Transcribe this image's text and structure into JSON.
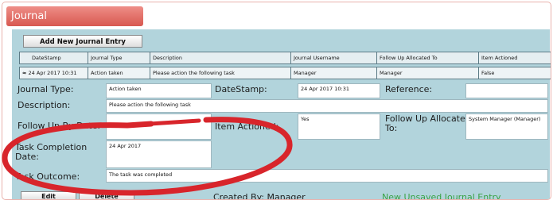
{
  "panel": {
    "title": "Journal"
  },
  "toolbar": {
    "add_label": "Add New Journal Entry"
  },
  "grid": {
    "headers": [
      "DateStamp",
      "Journal Type",
      "Description",
      "Journal Username",
      "Follow Up Allocated To",
      "Item Actioned"
    ],
    "expand_glyph": "≈",
    "row": [
      "24 Apr 2017 10:31",
      "Action taken",
      "Please action the following task",
      "Manager",
      "Manager",
      "False"
    ]
  },
  "form": {
    "journal_type_label": "Journal Type:",
    "journal_type_value": "Action taken",
    "datestamp_label": "DateStamp:",
    "datestamp_value": "24 Apr 2017 10:31",
    "reference_label": "Reference:",
    "reference_value": "",
    "description_label": "Description:",
    "description_value": "Please action the following task",
    "follow_up_by_date_label": "Follow Up By Date:",
    "follow_up_by_date_value": "",
    "item_actioned_label": "Item Actioned:",
    "item_actioned_value": "Yes",
    "follow_up_allocated_label_1": "Follow Up Allocated",
    "follow_up_allocated_label_2": "To:",
    "follow_up_allocated_value": "System Manager (Manager)",
    "task_completion_label_1": "Task Completion",
    "task_completion_label_2": "Date:",
    "task_completion_value": "24 Apr 2017",
    "task_outcome_label": "Task Outcome:",
    "task_outcome_value": "The task was completed"
  },
  "footer": {
    "edit_label": "Edit",
    "delete_label": "Delete",
    "created_by": "Created By: Manager",
    "status": "New Unsaved Journal Entry"
  },
  "colors": {
    "header_red": "#d85950",
    "content_blue": "#b2d4dc",
    "annotation_red": "#d8252b",
    "status_green": "#3aa246"
  }
}
